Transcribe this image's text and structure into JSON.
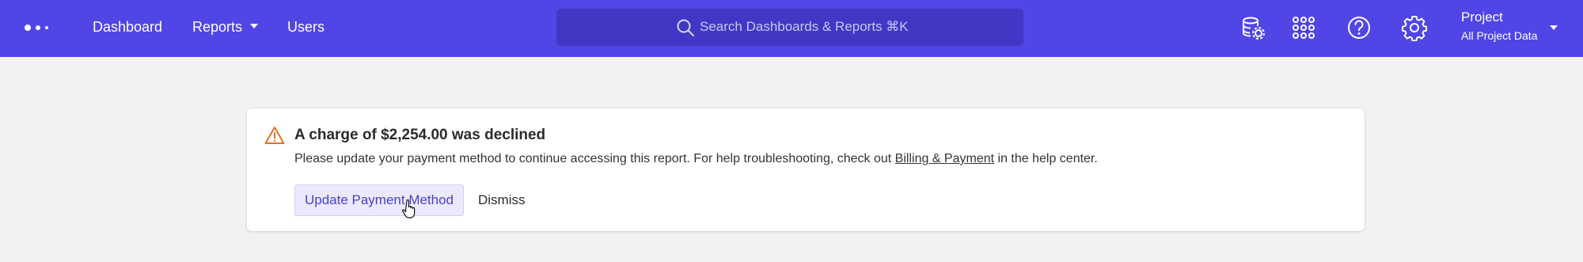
{
  "nav": {
    "dashboard": "Dashboard",
    "reports": "Reports",
    "users": "Users"
  },
  "search": {
    "placeholder": "Search Dashboards & Reports ⌘K"
  },
  "project": {
    "title": "Project",
    "subtitle": "All Project Data"
  },
  "icons": {
    "logo": "dots-logo-icon",
    "database": "database-settings-icon",
    "apps": "apps-grid-icon",
    "help": "help-icon",
    "settings": "gear-icon",
    "warning": "warning-icon"
  },
  "alert": {
    "title": "A charge of $2,254.00 was declined",
    "body_before": "Please update your payment method to continue accessing this report. For help troubleshooting, check out ",
    "link": "Billing & Payment",
    "body_after": " in the help center.",
    "primary_button": "Update Payment Method",
    "secondary_button": "Dismiss"
  },
  "colors": {
    "brand": "#5046e5",
    "search_bg": "#4038c4",
    "warning": "#e0702a",
    "primary_button_bg": "#ebe9fb",
    "primary_button_text": "#4b3fd1"
  }
}
